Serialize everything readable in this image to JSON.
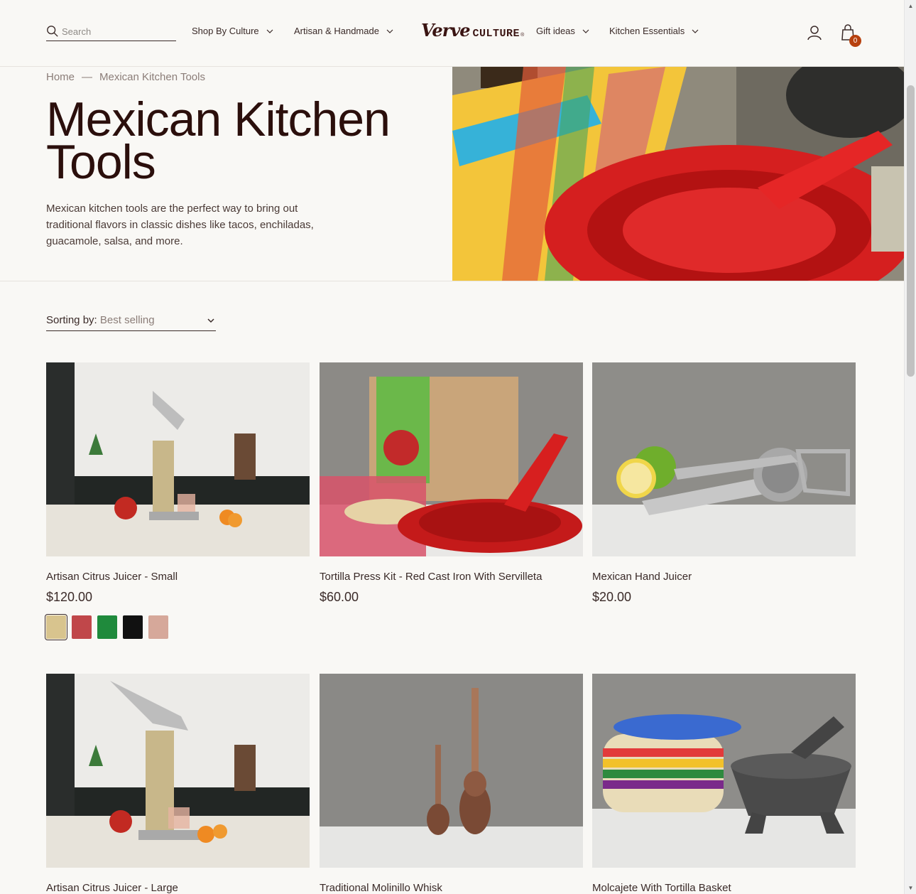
{
  "header": {
    "search_placeholder": "Search",
    "nav_left": [
      {
        "label": "Shop By Culture"
      },
      {
        "label": "Artisan & Handmade"
      }
    ],
    "logo": {
      "script": "Verve",
      "caps": "CULTURE",
      "reg": "®"
    },
    "nav_right": [
      {
        "label": "Gift ideas"
      },
      {
        "label": "Kitchen Essentials"
      }
    ],
    "cart_count": "0"
  },
  "breadcrumb": {
    "home": "Home",
    "separator": "—",
    "current": "Mexican Kitchen Tools"
  },
  "hero": {
    "title": "Mexican Kitchen Tools",
    "description": "Mexican kitchen tools are the perfect way to bring out traditional flavors in classic dishes like tacos, enchiladas, guacamole, salsa, and more."
  },
  "sort": {
    "label": "Sorting by:",
    "value": "Best selling"
  },
  "products": [
    {
      "name": "Artisan Citrus Juicer - Small",
      "price": "$120.00",
      "swatches": [
        "#d8c48e",
        "#c0474a",
        "#1f8a3c",
        "#111111",
        "#d6a89a"
      ]
    },
    {
      "name": "Tortilla Press Kit - Red Cast Iron With Servilleta",
      "price": "$60.00"
    },
    {
      "name": "Mexican Hand Juicer",
      "price": "$20.00"
    },
    {
      "name": "Artisan Citrus Juicer - Large",
      "price": ""
    },
    {
      "name": "Traditional Molinillo Whisk",
      "price": ""
    },
    {
      "name": "Molcajete With Tortilla Basket",
      "price": ""
    }
  ],
  "colors": {
    "accent": "#b7410e",
    "text": "#3a2a28",
    "title": "#2b0f0c",
    "background": "#f9f8f5"
  }
}
